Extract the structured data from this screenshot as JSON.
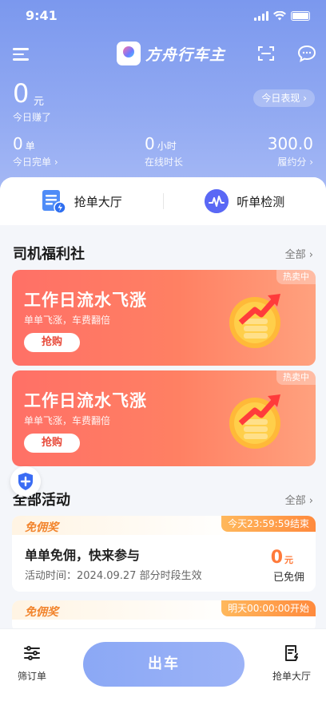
{
  "status": {
    "time": "9:41"
  },
  "header": {
    "brand": "方舟行车主"
  },
  "earnings": {
    "amount": "0",
    "unit": "元",
    "label": "今日赚了",
    "today_button": "今日表现 ›"
  },
  "stats": [
    {
      "value": "0",
      "unit": "单",
      "label": "今日完单 ›"
    },
    {
      "value": "0",
      "unit": "小时",
      "label": "在线时长"
    },
    {
      "value": "300.0",
      "unit": "",
      "label": "履约分 ›"
    }
  ],
  "quick_actions": [
    {
      "label": "抢单大厅",
      "icon": "order-hall-icon"
    },
    {
      "label": "听单检测",
      "icon": "listen-check-icon"
    }
  ],
  "welfare": {
    "title": "司机福利社",
    "all": "全部 ›",
    "promos": [
      {
        "tag": "热卖中",
        "title": "工作日流水飞涨",
        "subtitle": "单单飞涨，车费翻倍",
        "button": "抢购"
      },
      {
        "tag": "热卖中",
        "title": "工作日流水飞涨",
        "subtitle": "单单飞涨，车费翻倍",
        "button": "抢购"
      }
    ]
  },
  "activities": {
    "title": "全部活动",
    "all": "全部 ›",
    "items": [
      {
        "badge": "免佣奖",
        "time_tag": "今天23:59:59结束",
        "title": "单单免佣，快来参与",
        "desc": "活动时间：2024.09.27 部分时段生效",
        "amount": "0",
        "amount_unit": "元",
        "amount_label": "已免佣"
      },
      {
        "badge": "免佣奖",
        "time_tag": "明天00:00:00开始"
      }
    ]
  },
  "tabbar": {
    "left": "筛订单",
    "center": "出车",
    "right": "抢单大厅"
  },
  "colors": {
    "primary": "#7b98ee",
    "promo_red": "#ff7066",
    "accent_orange": "#ff7a3a"
  }
}
